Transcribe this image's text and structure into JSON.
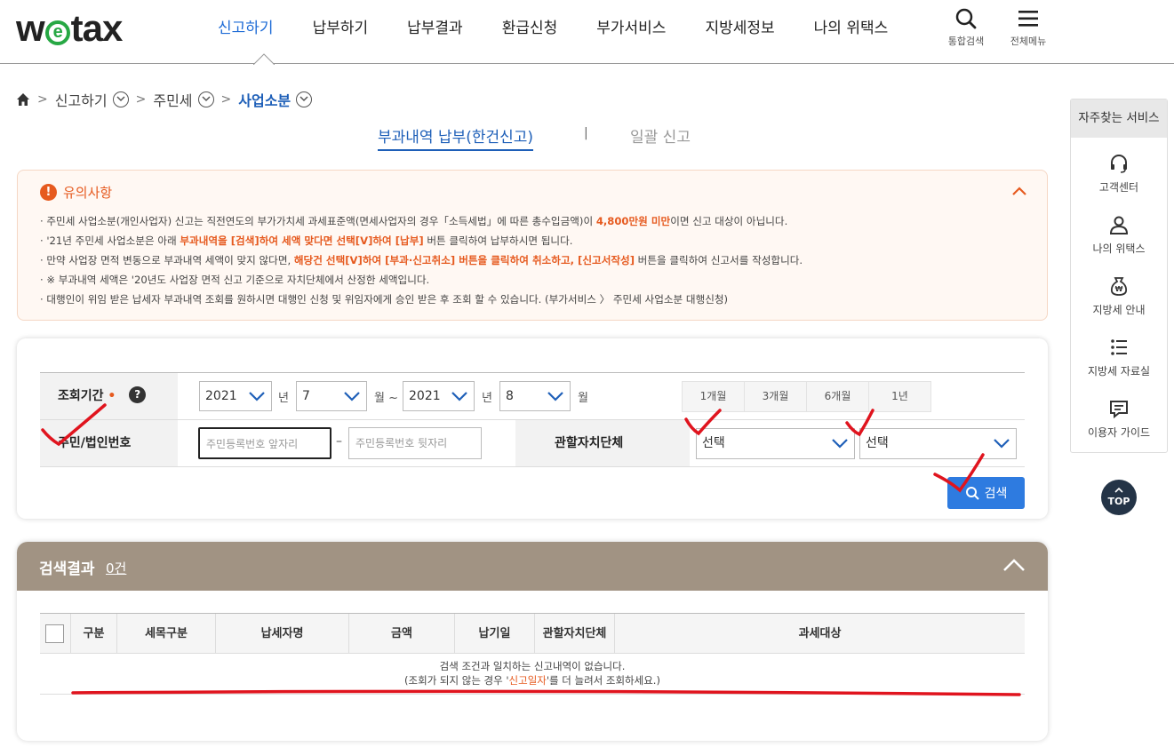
{
  "header": {
    "logo_prefix": "w",
    "logo_e": "e",
    "logo_suffix": "tax",
    "nav": [
      "신고하기",
      "납부하기",
      "납부결과",
      "환급신청",
      "부가서비스",
      "지방세정보",
      "나의 위택스"
    ],
    "active_nav": "신고하기",
    "search_label": "통합검색",
    "menu_label": "전체메뉴",
    "icons": [
      "search-icon",
      "hamburger-menu-icon"
    ]
  },
  "breadcrumb": {
    "items": [
      "신고하기",
      "주민세",
      "사업소분"
    ],
    "home_icon": "home-icon"
  },
  "tabs": {
    "active": "부과내역 납부(한건신고)",
    "separator": "|",
    "inactive": "일괄 신고"
  },
  "notice": {
    "title": "유의사항",
    "icon": "!",
    "line1_a": "· 주민세 사업소분(개인사업자) 신고는 직전연도의 부가가치세 과세표준액(면세사업자의 경우「소득세법」에 따른 총수입금액)이 ",
    "line1_b": "4,800만원 미만",
    "line1_c": "이면 신고 대상이 아닙니다.",
    "line2_a": "· '21년 주민세 사업소분은 아래 ",
    "line2_b": "부과내역을 [검색]하여 세액 맞다면 선택[V]하여 [납부]",
    "line2_c": " 버튼 클릭하여 납부하시면 됩니다.",
    "line3_a": "· 만약 사업장 면적 변동으로 부과내역 세액이 맞지 않다면, ",
    "line3_b": "해당건 선택[V]하여 [부과·신고취소] 버튼을 클릭하여 취소하고, [신고서작성]",
    "line3_c": " 버튼을 클릭하여 신고서를 작성합니다.",
    "line4": "· ※ 부과내역 세액은 '20년도 사업장 면적 신고 기준으로 자치단체에서 산정한 세액입니다.",
    "line5": "· 대행인이 위임 받은 납세자 부과내역 조회를 원하시면 대행인 신청 및 위임자에게 승인 받은 후 조회 할 수 있습니다. (부가서비스 〉 주민세 사업소분 대행신청)"
  },
  "form": {
    "period_label": "조회기간",
    "required_mark": "•",
    "help": "?",
    "start_year": "2021",
    "start_month": "7",
    "end_year": "2021",
    "end_month": "8",
    "year_unit": "년",
    "month_unit_tilde": "월 ~",
    "month_unit": "월",
    "period_buttons": [
      "1개월",
      "3개월",
      "6개월",
      "1년"
    ],
    "id_label": "주민/법인번호",
    "id_front_placeholder": "주민등록번호 앞자리",
    "id_dash": "–",
    "id_back_placeholder": "주민등록번호 뒷자리",
    "region_label": "관할자치단체",
    "region_select1": "선택",
    "region_select2": "선택",
    "search_button": "검색"
  },
  "results": {
    "title": "검색결과",
    "count": "0건",
    "columns": [
      "구분",
      "세목구분",
      "납세자명",
      "금액",
      "납기일",
      "관할자치단체",
      "과세대상"
    ],
    "empty_line1": "검색 조건과 일치하는 신고내역이 없습니다.",
    "empty_line2_a": "(조회가 되지 않는 경우 '",
    "empty_line2_b": "신고일자",
    "empty_line2_c": "'를 더 늘려서 조회하세요.)"
  },
  "quick_menu": {
    "title": "자주찾는 서비스",
    "items": [
      "고객센터",
      "나의 위택스",
      "지방세 안내",
      "지방세 자료실",
      "이용자 가이드"
    ],
    "icons": [
      "headset-icon",
      "user-icon",
      "money-bag-icon",
      "list-icon",
      "chat-icon"
    ]
  },
  "top_button": "TOP",
  "colors": {
    "accent_blue": "#1e6bd6",
    "notice_orange": "#e65a1f",
    "results_header": "#a19383",
    "search_button": "#2e7be0",
    "annotation_red": "#e0141e"
  }
}
